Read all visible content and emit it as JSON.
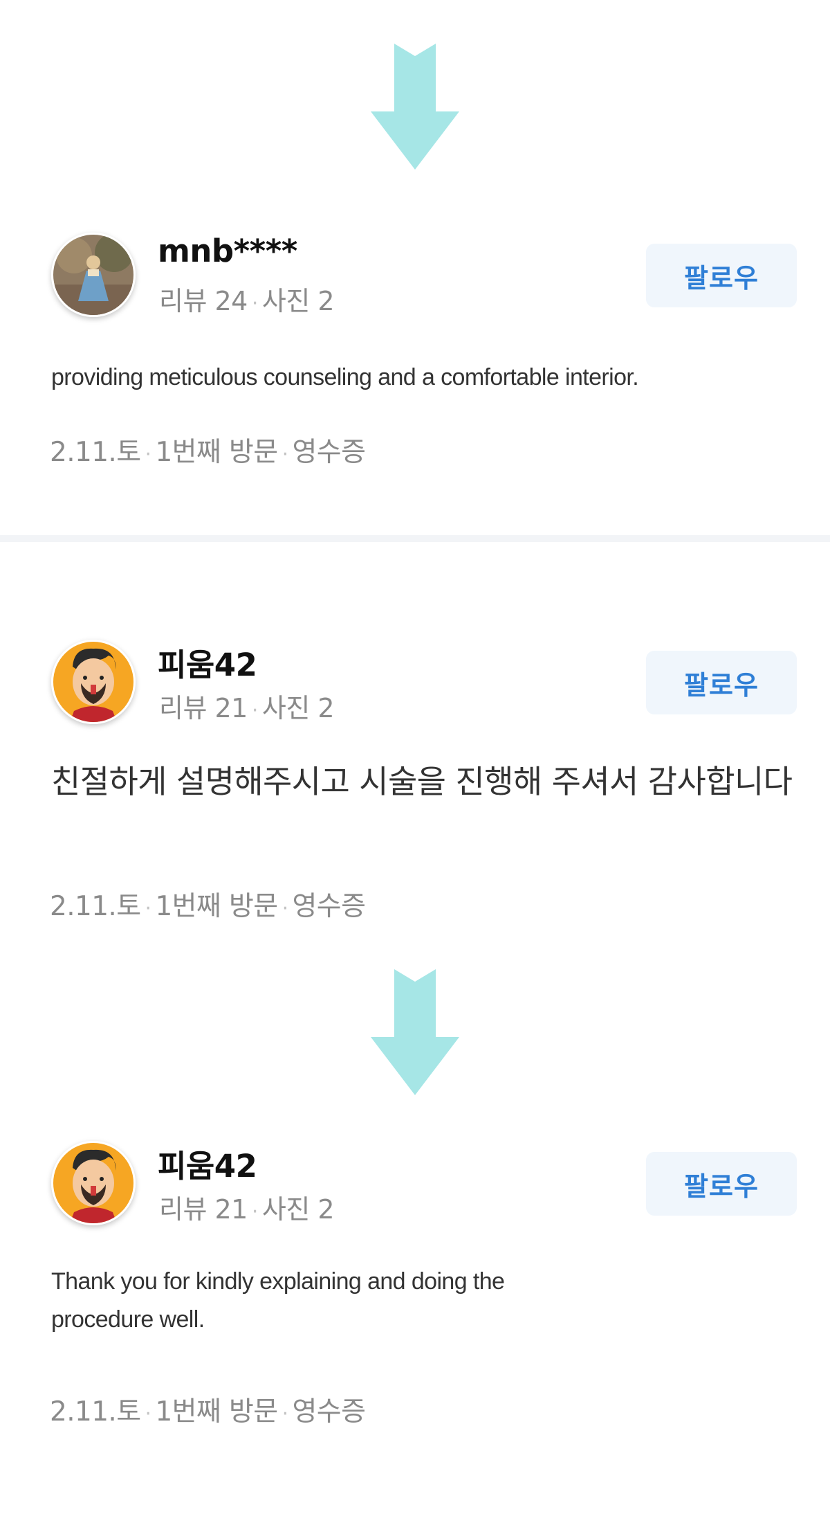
{
  "colors": {
    "arrow": "#a6e6e6",
    "follow_text": "#2f7fd6",
    "follow_bg": "#f0f6fc",
    "meta_text": "#8a8a8a",
    "divider": "#f2f4f7"
  },
  "reviews": [
    {
      "avatar_icon": "user-avatar-photo",
      "nickname": "mnb****",
      "reviews_label": "리뷰 24",
      "photos_label": "사진 2",
      "follow_label": "팔로우",
      "text": "providing meticulous counseling and a comfortable interior.",
      "visit": {
        "date": "2.11.토",
        "count": "1번째 방문",
        "receipt": "영수증"
      }
    },
    {
      "avatar_icon": "cartoon-avatar",
      "nickname": "피움42",
      "reviews_label": "리뷰 21",
      "photos_label": "사진 2",
      "follow_label": "팔로우",
      "text": "친절하게 설명해주시고 시술을 진행해 주셔서 감사합니다",
      "visit": {
        "date": "2.11.토",
        "count": "1번째 방문",
        "receipt": "영수증"
      }
    },
    {
      "avatar_icon": "cartoon-avatar",
      "nickname": "피움42",
      "reviews_label": "리뷰 21",
      "photos_label": "사진 2",
      "follow_label": "팔로우",
      "text": "Thank you for kindly explaining and doing the procedure well.",
      "visit": {
        "date": "2.11.토",
        "count": "1번째 방문",
        "receipt": "영수증"
      }
    }
  ],
  "separator": "·"
}
